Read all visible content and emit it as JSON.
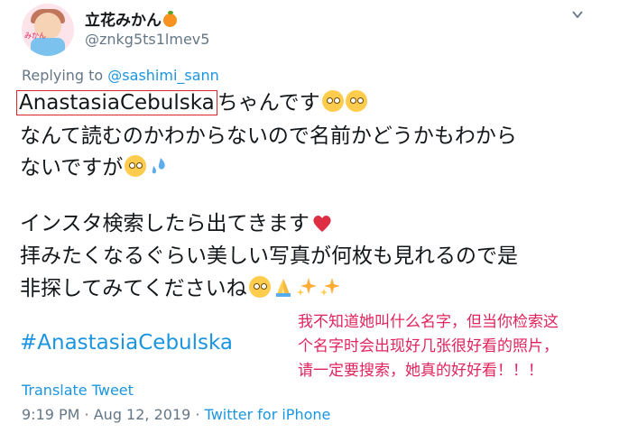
{
  "tweet": {
    "display_name": "立花みかん",
    "handle": "@znkg5ts1lmev5",
    "avatar_label": "みかん",
    "replying_prefix": "Replying to",
    "replying_to": "@sashimi_sann",
    "highlighted_name": "AnastasiaCebulska",
    "line1_rest": "ちゃんです",
    "line2": "なんて読むのかわからないので名前かどうかもわから",
    "line3": "ないですが",
    "line4": "インスタ検索したら出てきます",
    "line5": "拝みたくなるぐらい美しい写真が何枚も見れるので是",
    "line6": "非探してみてくださいね",
    "hashtag": "#AnastasiaCebulska",
    "translate_label": "Translate Tweet",
    "timestamp": "9:19 PM · Aug 12, 2019 · ",
    "source": "Twitter for iPhone"
  },
  "annotation": {
    "line1": "我不知道她叫什么名字，但当你检索这",
    "line2": "个名字时会出现好几张很好看的照片，",
    "line3": "请一定要搜索，她真的好好看！！！"
  },
  "colors": {
    "link": "#1b95e0",
    "muted": "#657786",
    "annotation": "#e0245e",
    "highlight_box": "#d9262c"
  },
  "icons": [
    "chevron-down-icon",
    "eye-roll-emoji-icon",
    "crying-emoji-icon",
    "sweat-drops-icon",
    "heart-icon",
    "folded-hands-icon",
    "sparkles-icon",
    "orange-icon"
  ]
}
